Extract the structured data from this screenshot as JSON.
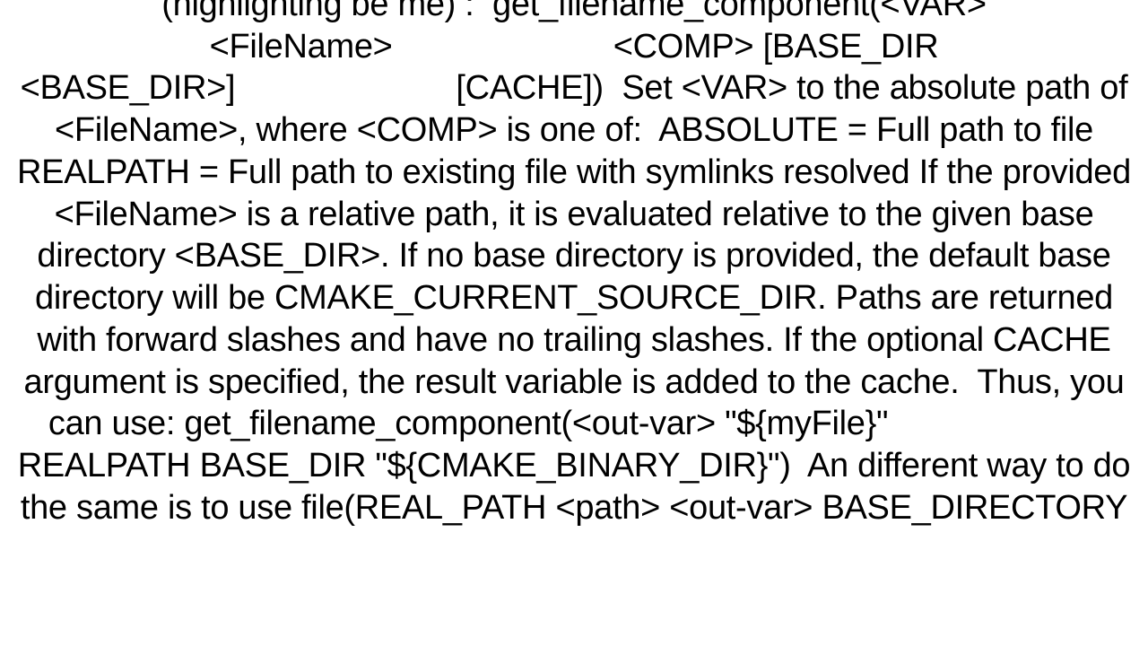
{
  "document": {
    "body": "(highlighting be me) :  get_filename_component(<VAR> <FileName>                        <COMP> [BASE_DIR <BASE_DIR>]                        [CACHE])  Set <VAR> to the absolute path of <FileName>, where <COMP> is one of:  ABSOLUTE = Full path to file REALPATH = Full path to existing file with symlinks resolved If the provided <FileName> is a relative path, it is evaluated relative to the given base directory <BASE_DIR>. If no base directory is provided, the default base directory will be CMAKE_CURRENT_SOURCE_DIR. Paths are returned with forward slashes and have no trailing slashes. If the optional CACHE argument is specified, the result variable is added to the cache.  Thus, you can use: get_filename_component(<out-var> \"${myFile}\"                        REALPATH BASE_DIR \"${CMAKE_BINARY_DIR}\")  An different way to do the same is to use file(REAL_PATH <path> <out-var> BASE_DIRECTORY"
  }
}
